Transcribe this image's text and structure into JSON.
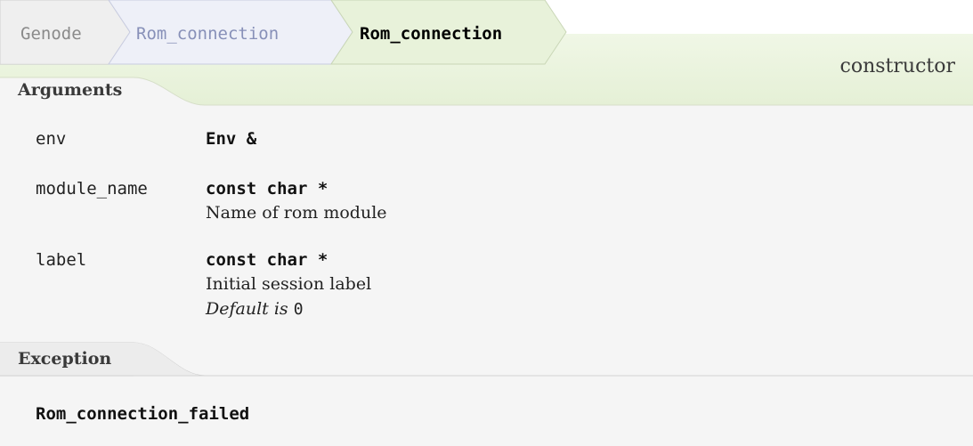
{
  "breadcrumb": {
    "items": [
      "Genode",
      "Rom_connection",
      "Rom_connection"
    ]
  },
  "kind": "constructor",
  "sections": {
    "arguments_title": "Arguments",
    "exception_title": "Exception"
  },
  "arguments": [
    {
      "name": "env",
      "type": "Env &"
    },
    {
      "name": "module_name",
      "type": "const char *",
      "description": "Name of rom module"
    },
    {
      "name": "label",
      "type": "const char *",
      "description": "Initial session label",
      "default_prefix": "Default is ",
      "default_value": "0"
    }
  ],
  "exception": {
    "name": "Rom_connection_failed"
  },
  "colors": {
    "header_green": "#e8f2da",
    "body_grey": "#f5f5f5",
    "crumb_grey": "#8a8a8a",
    "crumb_blue": "#8790b8"
  }
}
